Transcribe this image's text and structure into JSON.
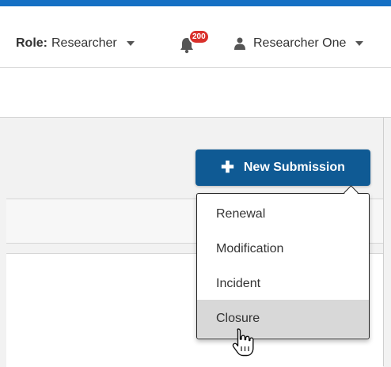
{
  "header": {
    "role_label": "Role:",
    "role_value": "Researcher",
    "notifications_count": "200",
    "user_name": "Researcher One"
  },
  "actions": {
    "new_submission_label": "New Submission"
  },
  "dropdown": {
    "items": [
      {
        "label": "Renewal"
      },
      {
        "label": "Modification"
      },
      {
        "label": "Incident"
      },
      {
        "label": "Closure"
      }
    ],
    "hovered_item": "Closure"
  },
  "colors": {
    "topbar": "#1570c4",
    "button": "#0f5a94",
    "badge": "#d9302b",
    "hover": "#d8d8d8"
  },
  "icons": [
    "chevron-down-icon",
    "bell-icon",
    "user-icon",
    "plus-icon",
    "hand-pointer-icon"
  ]
}
